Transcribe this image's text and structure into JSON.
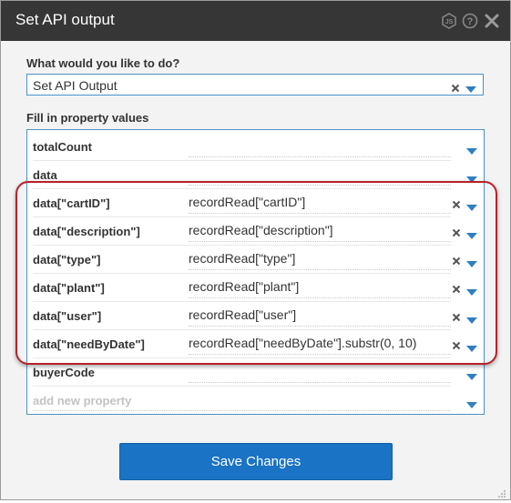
{
  "window": {
    "title": "Set API output",
    "icons": [
      "js-icon",
      "help-icon",
      "close-icon"
    ]
  },
  "action_section": {
    "label": "What would you like to do?",
    "selected_value": "Set API Output"
  },
  "properties_section": {
    "label": "Fill in property values",
    "rows": [
      {
        "name": "totalCount",
        "value": "",
        "clearable": false
      },
      {
        "name": "data",
        "value": "",
        "clearable": false
      },
      {
        "name": "data[\"cartID\"]",
        "value": "recordRead[\"cartID\"]",
        "clearable": true
      },
      {
        "name": "data[\"description\"]",
        "value": "recordRead[\"description\"]",
        "clearable": true
      },
      {
        "name": "data[\"type\"]",
        "value": "recordRead[\"type\"]",
        "clearable": true
      },
      {
        "name": "data[\"plant\"]",
        "value": "recordRead[\"plant\"]",
        "clearable": true
      },
      {
        "name": "data[\"user\"]",
        "value": "recordRead[\"user\"]",
        "clearable": true
      },
      {
        "name": "data[\"needByDate\"]",
        "value": "recordRead[\"needByDate\"].substr(0, 10)",
        "clearable": true
      },
      {
        "name": "buyerCode",
        "value": "",
        "clearable": false
      }
    ],
    "new_property_placeholder": "add new property"
  },
  "footer": {
    "save_label": "Save Changes"
  },
  "colors": {
    "titlebar": "#363636",
    "accent": "#1a73c4",
    "highlight": "#b8202a"
  }
}
